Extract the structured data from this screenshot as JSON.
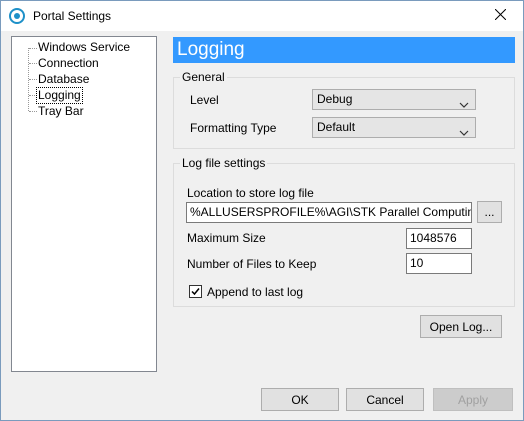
{
  "window": {
    "title": "Portal Settings"
  },
  "tree": {
    "items": [
      {
        "label": "Windows Service"
      },
      {
        "label": "Connection"
      },
      {
        "label": "Database"
      },
      {
        "label": "Logging",
        "selected": true
      },
      {
        "label": "Tray Bar"
      }
    ]
  },
  "panel": {
    "header": "Logging",
    "general": {
      "title": "General",
      "level_label": "Level",
      "level_value": "Debug",
      "format_label": "Formatting Type",
      "format_value": "Default"
    },
    "logfile": {
      "title": "Log file settings",
      "location_label": "Location to store log file",
      "location_value": "%ALLUSERSPROFILE%\\AGI\\STK Parallel Computing Serv",
      "browse_label": "...",
      "max_size_label": "Maximum Size",
      "max_size_value": "1048576",
      "files_label": "Number of Files to Keep",
      "files_value": "10",
      "append_label": "Append to last log",
      "append_checked": true
    },
    "open_log_label": "Open Log..."
  },
  "footer": {
    "ok_label": "OK",
    "cancel_label": "Cancel",
    "apply_label": "Apply"
  },
  "colors": {
    "header_bg": "#3399ff",
    "title_icon": "#1e90c8"
  }
}
